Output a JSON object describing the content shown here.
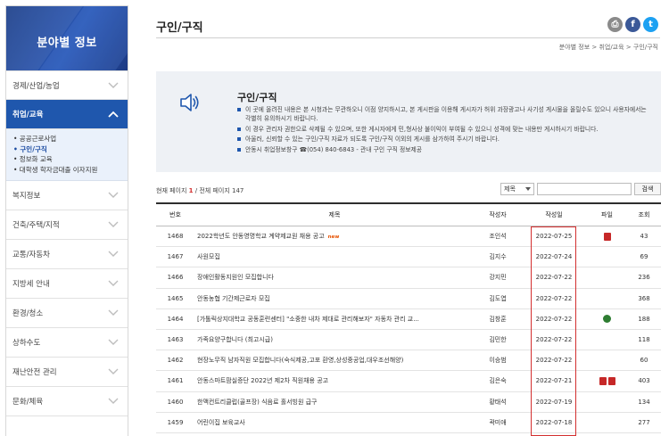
{
  "sidebar": {
    "title": "분야별 정보",
    "items": [
      {
        "label": "경제/산업/농업"
      },
      {
        "label": "취업/교육"
      },
      {
        "label": "복지정보"
      },
      {
        "label": "건축/주택/지적"
      },
      {
        "label": "교통/자동차"
      },
      {
        "label": "지방세 안내"
      },
      {
        "label": "환경/청소"
      },
      {
        "label": "상하수도"
      },
      {
        "label": "재난안전 관리"
      },
      {
        "label": "문화/체육"
      }
    ],
    "submenu": [
      {
        "label": "• 공공근로사업"
      },
      {
        "label": "• 구인/구직"
      },
      {
        "label": "• 정보화 교육"
      },
      {
        "label": "• 대학생 학자금대출 이자지원"
      }
    ]
  },
  "header": {
    "title": "구인/구직",
    "breadcrumb": "분야별 정보 > 취업/교육 > 구인/구직",
    "share": {
      "print": "⎙",
      "facebook": "f",
      "twitter": "t"
    }
  },
  "info": {
    "title": "구인/구직",
    "lines": [
      "이 곳에 올려진 내용은 본 시청과는 무관하오니 이점 양지하시고, 본 게시판을 이용해 게시자가 허위 과장광고나 사기성 게시물을 올릴수도 있으니 사용자에서는 각별히 유의하시기 바랍니다.",
      "이 경우 관리자 권한으로 삭제될 수 있으며, 또한 게시자에게 민,형사상 불이익이 부여될 수 있으니 성격에 맞는 내용만 게시하시기 바랍니다.",
      "아울러, 신뢰할 수 있는 구인/구직 자료가 되도록 구인/구직 이외의 게시를 삼가하여 주시기 바랍니다.",
      "안동시 취업정보창구 ☎(054) 840-6843 - 관내 구인 구직 정보제공"
    ]
  },
  "list": {
    "page_label_prefix": "현재 페이지 ",
    "current_page": "1",
    "page_label_suffix": " / 전체 페이지 147",
    "search_select": "제목",
    "search_button": "검색",
    "columns": {
      "no": "번호",
      "title": "제목",
      "author": "작성자",
      "date": "작성일",
      "file": "파일",
      "views": "조회"
    },
    "rows": [
      {
        "no": "1468",
        "title": "2022학년도 안동영명학교 계약제교원 채용 공고",
        "new": "new",
        "author": "조인석",
        "date": "2022-07-25",
        "views": "43",
        "files": [
          "pdf"
        ]
      },
      {
        "no": "1467",
        "title": "사원모집",
        "new": "",
        "author": "김지수",
        "date": "2022-07-24",
        "views": "69",
        "files": []
      },
      {
        "no": "1466",
        "title": "장애인활동지원인 모집합니다",
        "new": "",
        "author": "강지민",
        "date": "2022-07-22",
        "views": "236",
        "files": []
      },
      {
        "no": "1465",
        "title": "안동농협 기간제근로자 모집",
        "new": "",
        "author": "김도엽",
        "date": "2022-07-22",
        "views": "368",
        "files": []
      },
      {
        "no": "1464",
        "title": "[가톨릭상지대학교 공동훈련센터] \"소중한 내차 제대로 관리해보자\" 자동차 관리 교...",
        "new": "",
        "author": "김창훈",
        "date": "2022-07-22",
        "views": "188",
        "files": [
          "hwp"
        ]
      },
      {
        "no": "1463",
        "title": "가족요양구합니다 (최고시급)",
        "new": "",
        "author": "김민한",
        "date": "2022-07-22",
        "views": "118",
        "files": []
      },
      {
        "no": "1462",
        "title": "현장노무직 남자직원 모집합니다(숙식제공,고포 환영,상성중공업,대우조선해양)",
        "new": "",
        "author": "이승범",
        "date": "2022-07-22",
        "views": "60",
        "files": []
      },
      {
        "no": "1461",
        "title": "안동스마트팜실증단 2022년 제2차 직원채용 공고",
        "new": "",
        "author": "김은숙",
        "date": "2022-07-21",
        "views": "403",
        "files": [
          "pdf",
          "pdf"
        ]
      },
      {
        "no": "1460",
        "title": "한맥컨트리클럽(골프장) 식음료 홀서빙원 급구",
        "new": "",
        "author": "황태석",
        "date": "2022-07-19",
        "views": "134",
        "files": []
      },
      {
        "no": "1459",
        "title": "어린이집 보육교사",
        "new": "",
        "author": "곽미애",
        "date": "2022-07-18",
        "views": "277",
        "files": []
      }
    ]
  },
  "colors": {
    "accent": "#1f57ad",
    "highlight": "#d32f2f"
  }
}
